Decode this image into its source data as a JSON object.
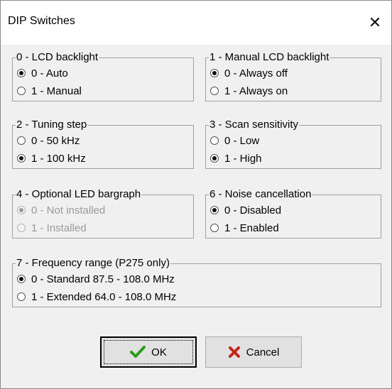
{
  "window": {
    "title": "DIP Switches"
  },
  "groups": [
    {
      "title": "0 - LCD backlight",
      "options": [
        {
          "label": "0 - Auto",
          "checked": true
        },
        {
          "label": "1 - Manual",
          "checked": false
        }
      ]
    },
    {
      "title": "1 - Manual LCD backlight",
      "options": [
        {
          "label": "0 - Always off",
          "checked": true
        },
        {
          "label": "1 - Always on",
          "checked": false
        }
      ]
    },
    {
      "title": "2 - Tuning step",
      "options": [
        {
          "label": "0 - 50 kHz",
          "checked": false
        },
        {
          "label": "1 - 100 kHz",
          "checked": true
        }
      ]
    },
    {
      "title": "3 - Scan sensitivity",
      "options": [
        {
          "label": "0 - Low",
          "checked": false
        },
        {
          "label": "1 - High",
          "checked": true
        }
      ]
    },
    {
      "title": "4 - Optional LED bargraph",
      "disabled": true,
      "options": [
        {
          "label": "0 - Not installed",
          "checked": true
        },
        {
          "label": "1 - Installed",
          "checked": false
        }
      ]
    },
    {
      "title": "6 - Noise cancellation",
      "options": [
        {
          "label": "0 - Disabled",
          "checked": true
        },
        {
          "label": "1 - Enabled",
          "checked": false
        }
      ]
    },
    {
      "title": "7 - Frequency range (P275 only)",
      "options": [
        {
          "label": "0 - Standard 87.5 - 108.0 MHz",
          "checked": true
        },
        {
          "label": "1 - Extended 64.0 - 108.0 MHz",
          "checked": false
        }
      ]
    }
  ],
  "buttons": {
    "ok": "OK",
    "cancel": "Cancel"
  },
  "icons": {
    "ok": "checkmark-icon",
    "cancel": "cross-icon",
    "ok_color": "#2e9b1e",
    "cancel_color": "#c8231a"
  }
}
